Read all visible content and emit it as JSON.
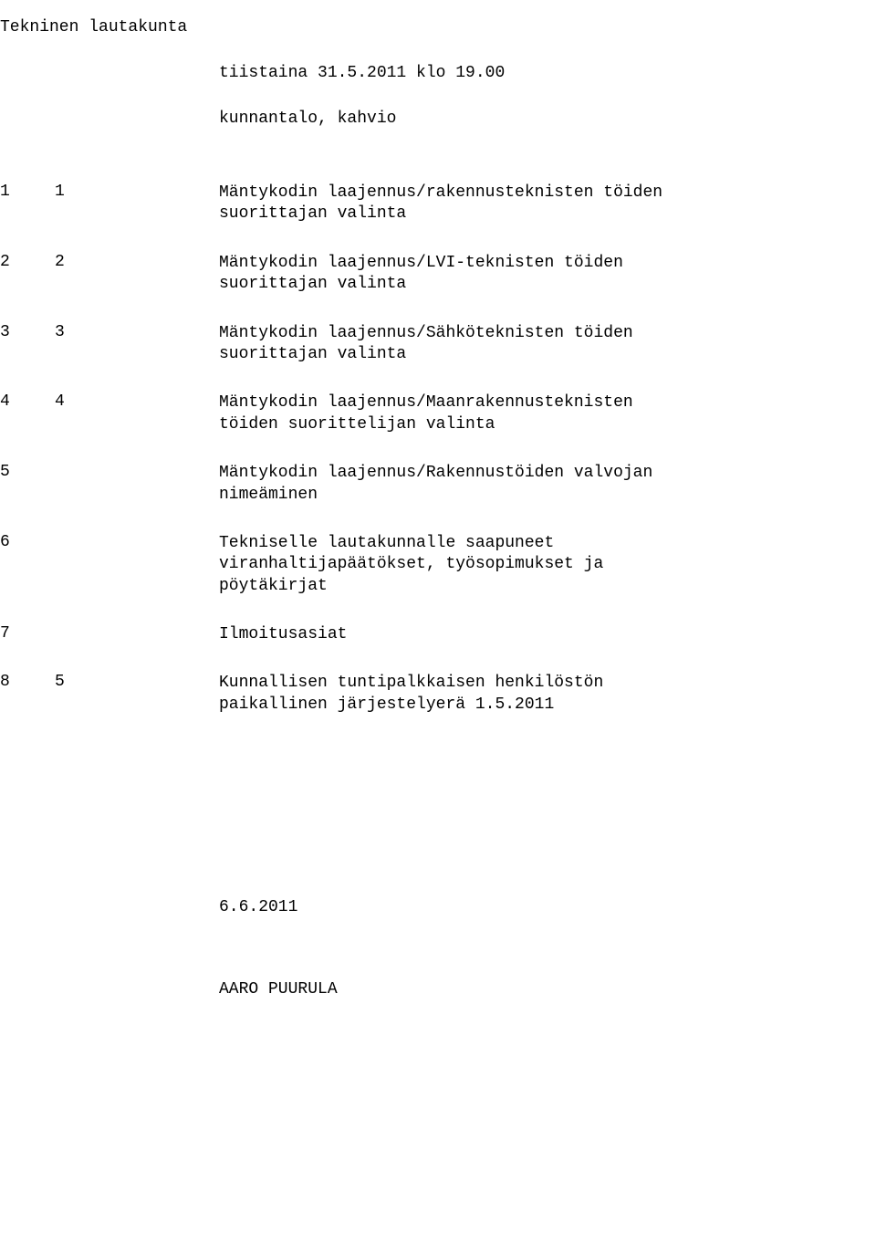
{
  "title": "Tekninen lautakunta",
  "datetime": "tiistaina 31.5.2011 klo 19.00",
  "location": "kunnantalo, kahvio",
  "agenda": [
    {
      "n1": "1",
      "n2": "1",
      "text": "Mäntykodin laajennus/rakennusteknisten töiden suorittajan valinta"
    },
    {
      "n1": "2",
      "n2": "2",
      "text": "Mäntykodin laajennus/LVI-teknisten töiden suorittajan valinta"
    },
    {
      "n1": "3",
      "n2": "3",
      "text": "Mäntykodin laajennus/Sähköteknisten töiden suorittajan valinta"
    },
    {
      "n1": "4",
      "n2": "4",
      "text": "Mäntykodin laajennus/Maanrakennusteknisten töiden suorittelijan valinta"
    },
    {
      "n1": "5",
      "n2": "",
      "text": "Mäntykodin laajennus/Rakennustöiden valvojan nimeäminen"
    },
    {
      "n1": "6",
      "n2": "",
      "text": "Tekniselle lautakunnalle saapuneet viranhaltijapäätökset, työsopimukset ja pöytäkirjat"
    },
    {
      "n1": "7",
      "n2": "",
      "text": "Ilmoitusasiat"
    },
    {
      "n1": "8",
      "n2": "5",
      "text": "Kunnallisen tuntipalkkaisen henkilöstön paikallinen järjestelyerä 1.5.2011"
    }
  ],
  "footer_date": "6.6.2011",
  "author": "AARO PUURULA"
}
